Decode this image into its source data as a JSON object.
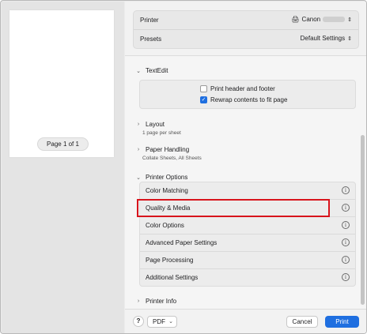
{
  "preview": {
    "page_label": "Page 1 of 1"
  },
  "printer": {
    "label": "Printer",
    "value": "Canon",
    "icon": "printer-icon"
  },
  "presets": {
    "label": "Presets",
    "value": "Default Settings"
  },
  "textedit": {
    "title": "TextEdit",
    "options": [
      {
        "label": "Print header and footer",
        "checked": false
      },
      {
        "label": "Rewrap contents to fit page",
        "checked": true
      }
    ]
  },
  "layout": {
    "title": "Layout",
    "subtitle": "1 page per sheet"
  },
  "paper_handling": {
    "title": "Paper Handling",
    "subtitle": "Collate Sheets, All Sheets"
  },
  "printer_options": {
    "title": "Printer Options",
    "items": [
      {
        "label": "Color Matching"
      },
      {
        "label": "Quality & Media"
      },
      {
        "label": "Color Options"
      },
      {
        "label": "Advanced Paper Settings"
      },
      {
        "label": "Page Processing"
      },
      {
        "label": "Additional Settings"
      }
    ],
    "highlight_color": "#d8141c"
  },
  "printer_info": {
    "title": "Printer Info"
  },
  "footer": {
    "help_label": "?",
    "pdf_label": "PDF",
    "cancel_label": "Cancel",
    "print_label": "Print",
    "accent_color": "#1f6fe0"
  }
}
